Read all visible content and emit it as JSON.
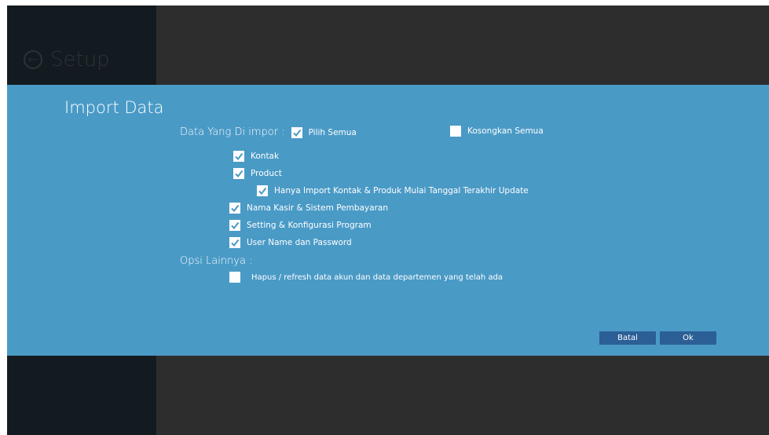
{
  "sidebar": {
    "title": "Setup",
    "back_icon": "back-arrow-circle-icon"
  },
  "dialog": {
    "title": "Import Data",
    "data_label": "Data Yang Di impor :",
    "select_all": {
      "label": "Pilih Semua",
      "checked": true
    },
    "clear_all": {
      "label": "Kosongkan Semua",
      "checked": false
    },
    "items": [
      {
        "label": "Kontak",
        "checked": true
      },
      {
        "label": "Product",
        "checked": true
      },
      {
        "label": "Hanya Import Kontak & Produk Mulai Tanggal Terakhir Update",
        "checked": true
      },
      {
        "label": "Nama Kasir & Sistem Pembayaran",
        "checked": true
      },
      {
        "label": "Setting & Konfigurasi Program",
        "checked": true
      },
      {
        "label": "User Name dan Password",
        "checked": true
      }
    ],
    "other_options_label": "Opsi Lainnya :",
    "other_options": [
      {
        "label": "Hapus / refresh data akun dan data departemen yang telah ada",
        "checked": false
      }
    ],
    "cancel_label": "Batal",
    "ok_label": "Ok"
  },
  "colors": {
    "dialog_bg": "#4a9ac6",
    "button_bg": "#2b5f96",
    "left_pane": "#141b20",
    "backdrop": "#2d2d2d"
  }
}
